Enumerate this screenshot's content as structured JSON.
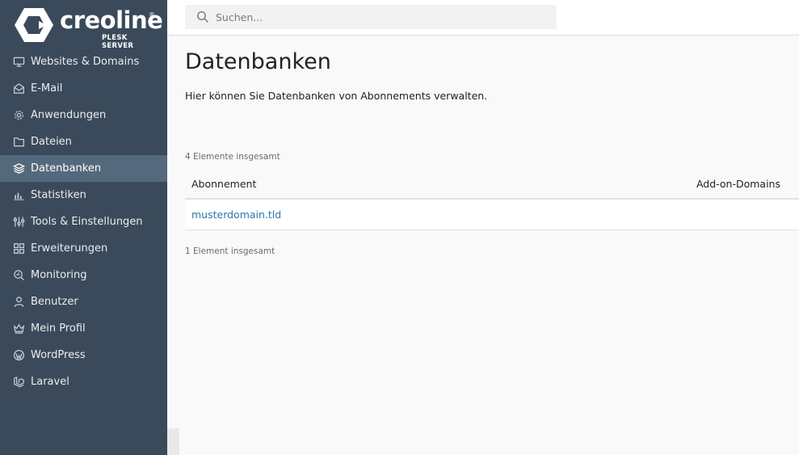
{
  "brand": {
    "name": "creoline",
    "registered": "®",
    "subtitle": "PLESK SERVER"
  },
  "search": {
    "placeholder": "Suchen..."
  },
  "sidebar": {
    "items": [
      {
        "label": "Websites & Domains",
        "icon": "monitor-icon"
      },
      {
        "label": "E-Mail",
        "icon": "envelope-icon"
      },
      {
        "label": "Anwendungen",
        "icon": "gear-icon"
      },
      {
        "label": "Dateien",
        "icon": "folder-icon"
      },
      {
        "label": "Datenbanken",
        "icon": "layers-icon",
        "active": true
      },
      {
        "label": "Statistiken",
        "icon": "bar-chart-icon"
      },
      {
        "label": "Tools & Einstellungen",
        "icon": "sliders-icon"
      },
      {
        "label": "Erweiterungen",
        "icon": "blocks-icon"
      },
      {
        "label": "Monitoring",
        "icon": "magnifier-chart-icon"
      },
      {
        "label": "Benutzer",
        "icon": "user-icon"
      },
      {
        "label": "Mein Profil",
        "icon": "crown-icon"
      },
      {
        "label": "WordPress",
        "icon": "wordpress-icon"
      },
      {
        "label": "Laravel",
        "icon": "laravel-icon"
      }
    ]
  },
  "main": {
    "title": "Datenbanken",
    "description": "Hier können Sie Datenbanken von Abonnements verwalten.",
    "total_top": "4 Elemente insgesamt",
    "total_bottom": "1 Element insgesamt",
    "table": {
      "columns": [
        "Abonnement",
        "Add-on-Domains"
      ],
      "rows": [
        {
          "subscription": "musterdomain.tld",
          "addon": ""
        }
      ]
    }
  },
  "colors": {
    "sidebar_bg": "#3b4a5a",
    "sidebar_active": "#55697c",
    "link": "#2b79a8"
  }
}
